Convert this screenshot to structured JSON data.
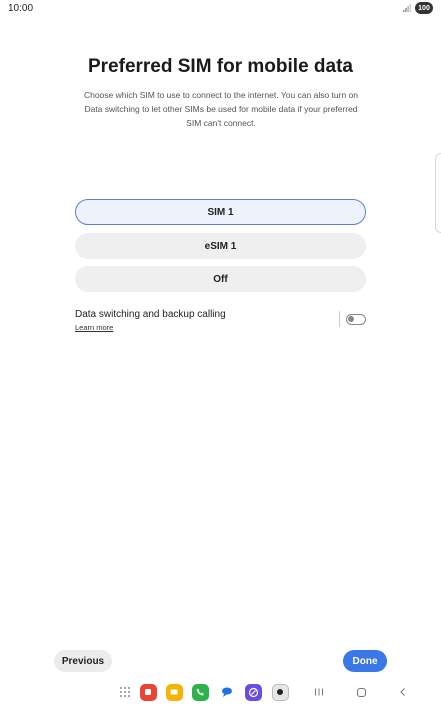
{
  "status": {
    "time": "10:00",
    "battery": "100"
  },
  "page": {
    "title": "Preferred SIM for mobile data",
    "description": "Choose which SIM to use to connect to the internet. You can also turn on Data switching to let other SIMs be used for mobile data if your preferred SIM can't connect."
  },
  "options": [
    {
      "label": "SIM 1",
      "selected": true
    },
    {
      "label": "eSIM 1",
      "selected": false
    },
    {
      "label": "Off",
      "selected": false
    }
  ],
  "toggle": {
    "label": "Data switching and backup calling",
    "link": "Learn more",
    "on": false
  },
  "footer": {
    "previous": "Previous",
    "done": "Done"
  },
  "nav": {
    "apps": [
      {
        "icon": "app-drawer-icon"
      },
      {
        "icon": "messages-app-icon",
        "color": "#e84333"
      },
      {
        "icon": "notes-app-icon",
        "color": "#f4b400"
      },
      {
        "icon": "phone-app-icon",
        "color": "#2db34a"
      },
      {
        "icon": "chat-app-icon",
        "color": "#1f6fe5"
      },
      {
        "icon": "browser-app-icon",
        "color": "#6a4de0"
      },
      {
        "icon": "camera-app-icon",
        "color": "#222222"
      }
    ],
    "system": [
      "recent-apps-icon",
      "home-icon",
      "back-icon"
    ]
  },
  "colors": {
    "accent": "#3a78e8",
    "selected_border": "#5a7fd6"
  }
}
